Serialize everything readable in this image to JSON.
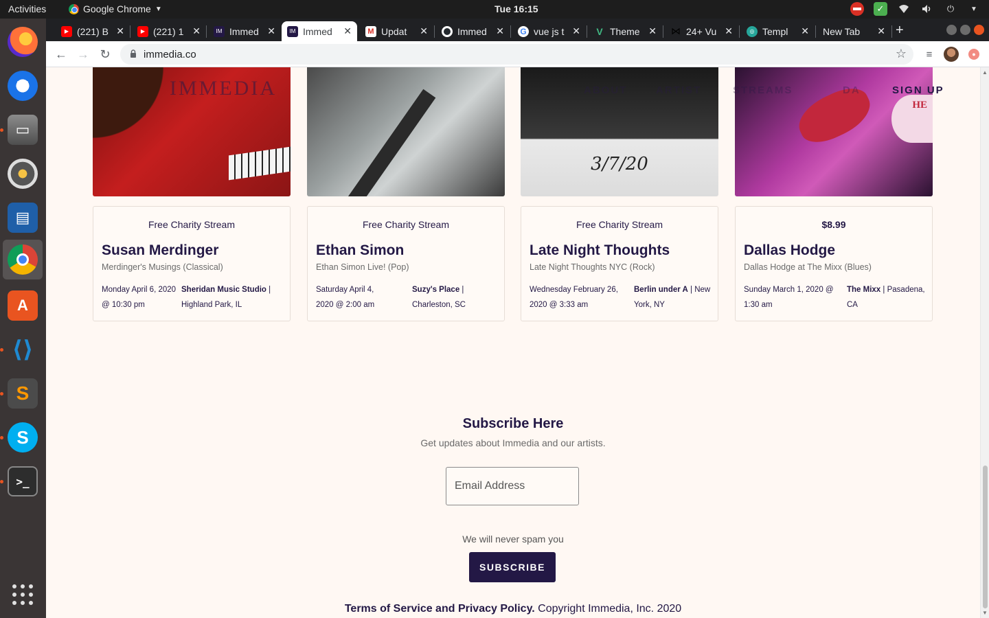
{
  "os": {
    "activities": "Activities",
    "app_name": "Google Chrome",
    "clock": "Tue 16:15"
  },
  "browser": {
    "tabs": [
      {
        "title": "(221) B",
        "favicon": "youtube-icon"
      },
      {
        "title": "(221) 1",
        "favicon": "youtube-icon"
      },
      {
        "title": "Immed",
        "favicon": "immedia-icon"
      },
      {
        "title": "Immed",
        "favicon": "immedia-icon",
        "active": true
      },
      {
        "title": "Updat",
        "favicon": "gmail-icon"
      },
      {
        "title": "Immed",
        "favicon": "github-icon"
      },
      {
        "title": "vue js t",
        "favicon": "google-icon"
      },
      {
        "title": "Theme",
        "favicon": "vue-icon"
      },
      {
        "title": "24+ Vu",
        "favicon": "bowtie-icon"
      },
      {
        "title": "Templ",
        "favicon": "template-icon"
      },
      {
        "title": "New Tab",
        "favicon": ""
      }
    ],
    "url": "immedia.co"
  },
  "site": {
    "brand": "IMMEDIA",
    "nav": [
      "ABOUT",
      "ARTIST",
      "STREAMS",
      "DA",
      "SIGN UP"
    ],
    "photo_date": "3/7/20",
    "photo_sign": "HE",
    "events": [
      {
        "price": "Free Charity Stream",
        "artist": "Susan Merdinger",
        "subtitle": "Merdinger's Musings (Classical)",
        "when": "Monday April 6, 2020 @ 10:30 pm",
        "venue": "Sheridan Music Studio",
        "location": "Highland Park, IL"
      },
      {
        "price": "Free Charity Stream",
        "artist": "Ethan Simon",
        "subtitle": "Ethan Simon Live! (Pop)",
        "when": "Saturday April 4, 2020 @ 2:00 am",
        "venue": "Suzy's Place",
        "location": "Charleston, SC"
      },
      {
        "price": "Free Charity Stream",
        "artist": "Late Night Thoughts",
        "subtitle": "Late Night Thoughts NYC (Rock)",
        "when": "Wednesday February 26, 2020 @ 3:33 am",
        "venue": "Berlin under A",
        "location": "New York, NY"
      },
      {
        "price": "$8.99",
        "artist": "Dallas Hodge",
        "subtitle": "Dallas Hodge at The Mixx (Blues)",
        "when": "Sunday March 1, 2020 @ 1:30 am",
        "venue": "The Mixx",
        "location": "Pasadena, CA"
      }
    ],
    "subscribe": {
      "title": "Subscribe Here",
      "subtitle": "Get updates about Immedia and our artists.",
      "email_placeholder": "Email Address",
      "note": "We will never spam you",
      "button": "SUBSCRIBE"
    },
    "footer": {
      "link": "Terms of Service and Privacy Policy.",
      "copyright": " Copyright Immedia, Inc. 2020"
    }
  },
  "colors": {
    "brand_dark": "#231845",
    "page_bg": "#fff8f3"
  }
}
